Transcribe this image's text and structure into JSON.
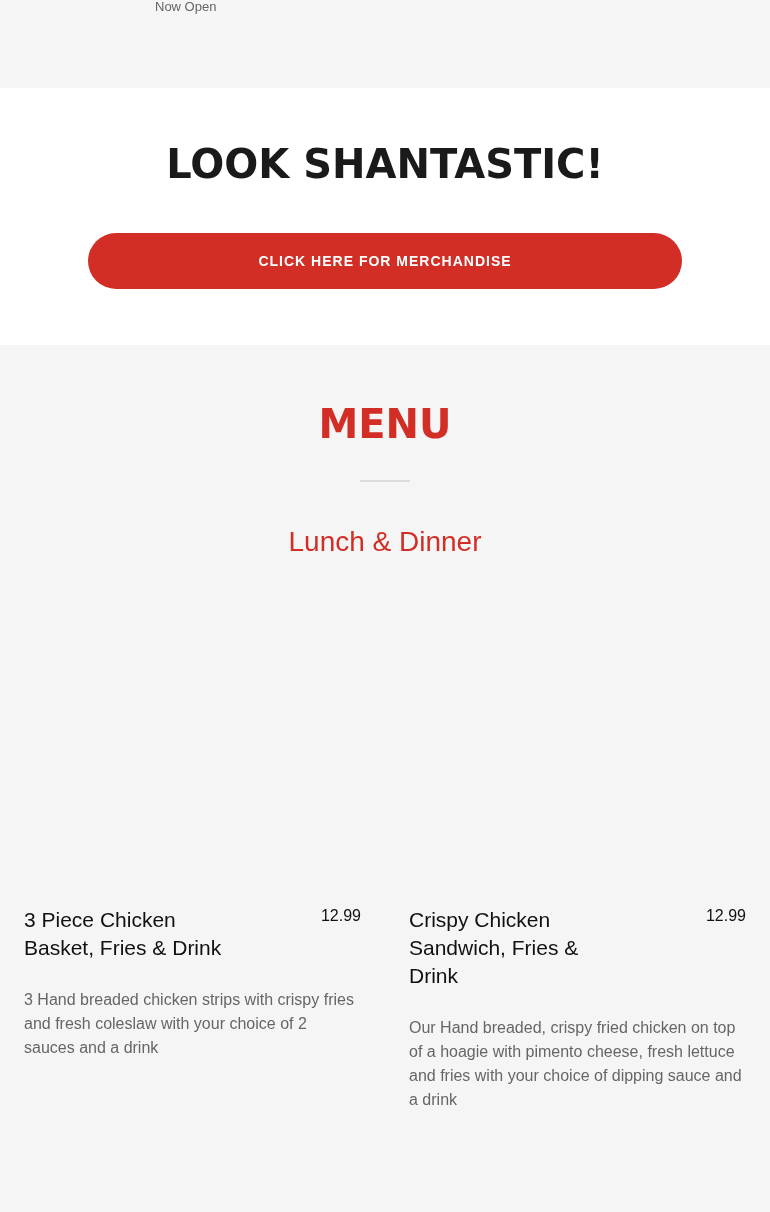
{
  "top_banner": {
    "text": "Now Open"
  },
  "merch": {
    "title": "LOOK SHANTASTIC!",
    "button": "CLICK HERE FOR MERCHANDISE"
  },
  "menu": {
    "title": "MENU",
    "section": "Lunch & Dinner",
    "items": [
      {
        "name": "3 Piece Chicken Basket, Fries & Drink",
        "price": "12.99",
        "description": "3 Hand breaded chicken strips with crispy fries and fresh coleslaw with your choice of 2 sauces and a drink"
      },
      {
        "name": "Crispy Chicken Sandwich, Fries & Drink",
        "price": "12.99",
        "description": "Our Hand breaded, crispy fried chicken on top of a hoagie with pimento cheese, fresh lettuce and fries with your choice of dipping sauce and a drink"
      }
    ]
  }
}
